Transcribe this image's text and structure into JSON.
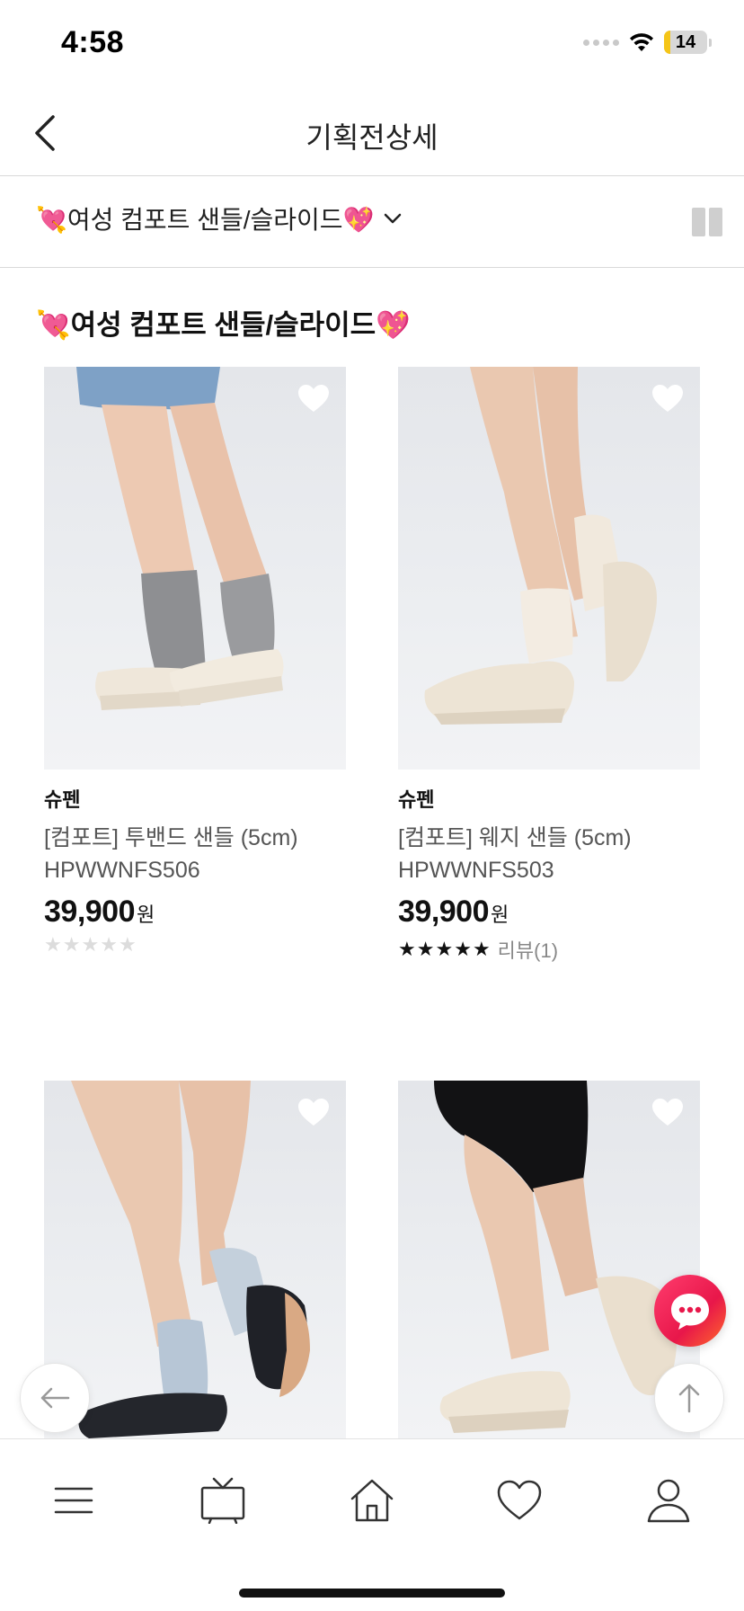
{
  "status_bar": {
    "time": "4:58",
    "battery": "14",
    "battery_level": 0.14
  },
  "header": {
    "title": "기획전상세",
    "back_icon": "chevron-left-icon"
  },
  "category_bar": {
    "selected": "💘여성 컴포트 샌들/슬라이드💖",
    "dropdown_icon": "chevron-down-icon",
    "view_icon": "grid-view-icon"
  },
  "section": {
    "title": "💘여성 컴포트 샌들/슬라이드💖"
  },
  "products": [
    {
      "brand": "슈펜",
      "name": "[컴포트] 투밴드 샌들 (5cm)",
      "code": "HPWWNFS506",
      "price": "39,900",
      "currency": "원",
      "rating": 0,
      "review": ""
    },
    {
      "brand": "슈펜",
      "name": "[컴포트] 웨지 샌들 (5cm)",
      "code": "HPWWNFS503",
      "price": "39,900",
      "currency": "원",
      "rating": 5,
      "review": "리뷰(1)"
    },
    {
      "brand": "",
      "name": "",
      "code": "",
      "price": "",
      "currency": "",
      "rating": 0,
      "review": ""
    },
    {
      "brand": "",
      "name": "",
      "code": "",
      "price": "",
      "currency": "",
      "rating": 0,
      "review": ""
    }
  ],
  "floating": {
    "back_icon": "arrow-left-icon",
    "top_icon": "arrow-up-icon",
    "chat_icon": "chat-bubble-icon"
  },
  "bottom_nav": {
    "items": [
      {
        "icon": "menu-icon"
      },
      {
        "icon": "tv-icon"
      },
      {
        "icon": "home-icon"
      },
      {
        "icon": "heart-icon"
      },
      {
        "icon": "user-icon"
      }
    ]
  },
  "colors": {
    "accent_chat": "#e8174a",
    "battery": "#f5c518",
    "star_filled": "#111111",
    "star_empty": "#dcdcdc"
  }
}
